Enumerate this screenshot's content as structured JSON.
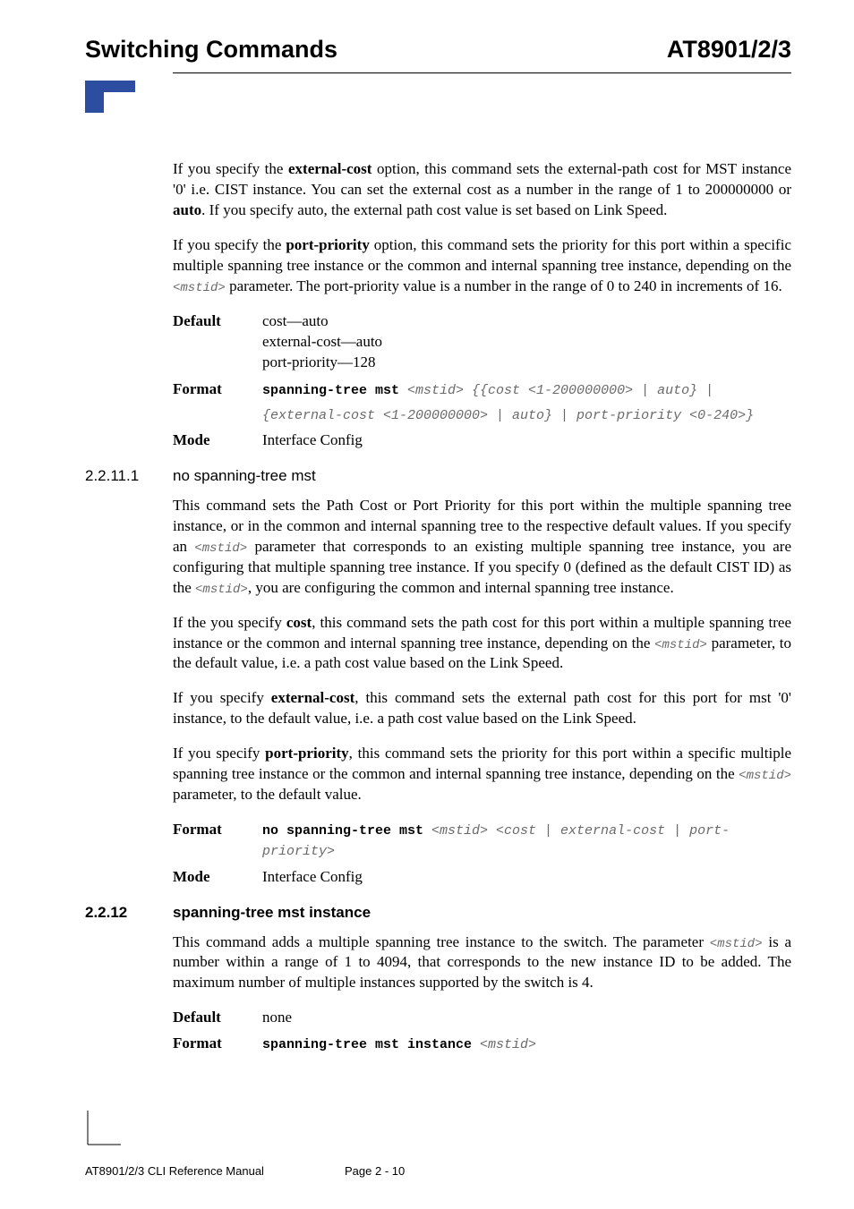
{
  "header": {
    "left": "Switching Commands",
    "right": "AT8901/2/3"
  },
  "intro": {
    "p1_a": "If you specify the ",
    "p1_b": "external-cost",
    "p1_c": " option, this command sets the external-path cost for MST instance '0' i.e. CIST instance. You can set the external cost as a number in the range of 1 to 200000000 or ",
    "p1_d": "auto",
    "p1_e": ". If you specify auto, the external path cost value is set based on Link Speed.",
    "p2_a": "If you specify the ",
    "p2_b": "port-priority",
    "p2_c": " option, this command sets the priority for this port within a specific multiple spanning tree instance or the common and internal spanning tree instance, depending on the ",
    "p2_d": "<mstid>",
    "p2_e": " parameter. The port-priority value is a number in the range of 0 to 240 in increments of 16."
  },
  "cmd1": {
    "default_label": "Default",
    "default_line1": "cost—auto",
    "default_line2": "external-cost—auto",
    "default_line3": "port-priority—128",
    "format_label": "Format",
    "format_bold": "spanning-tree mst ",
    "format_italic1": "<mstid> {{cost <1-200000000> | auto} |",
    "format_italic2": "{external-cost <1-200000000> | auto} | port-priority <0-240>}",
    "mode_label": "Mode",
    "mode_value": "Interface Config"
  },
  "sec1": {
    "num": "2.2.11.1",
    "title": "no spanning-tree mst",
    "p1_a": "This command sets the Path Cost or Port Priority for this port within the multiple spanning tree instance, or in the common and internal spanning tree to the respective default values. If you specify an ",
    "p1_b": "<mstid>",
    "p1_c": " parameter that corresponds to an existing multiple spanning tree instance, you are configuring that multiple spanning tree instance. If you specify 0 (defined as the default CIST ID) as the ",
    "p1_d": "<mstid>",
    "p1_e": ", you are configuring the common and internal spanning tree instance.",
    "p2_a": "If the you specify ",
    "p2_b": "cost",
    "p2_c": ", this command sets the path cost for this port within a multiple spanning tree instance or the common and internal spanning tree instance, depending on the ",
    "p2_d": "<mstid>",
    "p2_e": " parameter, to the default value, i.e. a path cost value based on the Link Speed.",
    "p3_a": "If you specify ",
    "p3_b": "external-cost",
    "p3_c": ", this command sets the external path cost for this port for mst '0' instance, to the default value, i.e. a path cost value based on the Link Speed.",
    "p4_a": "If you specify ",
    "p4_b": "port-priority",
    "p4_c": ", this command sets the priority for this port within a specific multiple spanning tree instance or the common and internal spanning tree instance, depending on the ",
    "p4_d": "<mstid>",
    "p4_e": " parameter, to the default value.",
    "format_label": "Format",
    "format_bold": "no spanning-tree mst ",
    "format_italic": "<mstid> <cost | external-cost | port-priority>",
    "mode_label": "Mode",
    "mode_value": "Interface Config"
  },
  "sec2": {
    "num": "2.2.12",
    "title": "spanning-tree mst instance",
    "p1_a": "This command adds a multiple spanning tree instance to the switch. The parameter ",
    "p1_b": "<mstid>",
    "p1_c": " is a number within a range of 1 to 4094, that corresponds to the new instance ID to be added. The maximum number of multiple instances supported by the switch is 4.",
    "default_label": "Default",
    "default_value": "none",
    "format_label": "Format",
    "format_bold": "spanning-tree mst instance ",
    "format_italic": "<mstid>"
  },
  "footer": {
    "manual": "AT8901/2/3 CLI Reference Manual",
    "page": "Page 2 - 10"
  }
}
